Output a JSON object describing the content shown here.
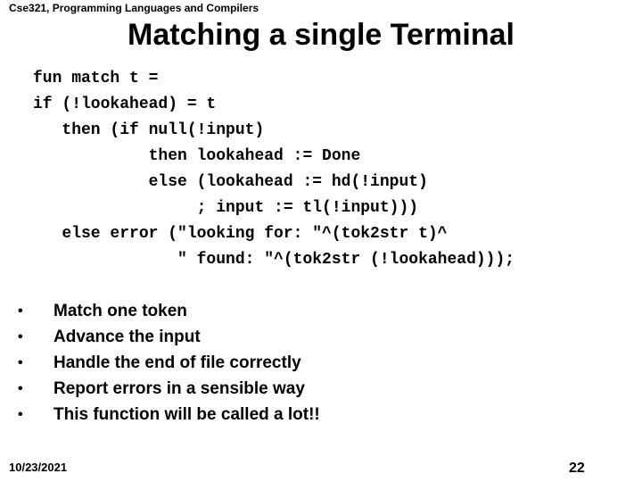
{
  "header": {
    "course": "Cse321, Programming Languages and Compilers"
  },
  "slide": {
    "title": "Matching a single Terminal",
    "code_lines": [
      "fun match t =",
      "if (!lookahead) = t",
      "   then (if null(!input)",
      "            then lookahead := Done",
      "            else (lookahead := hd(!input)",
      "                 ; input := tl(!input)))",
      "   else error (\"looking for: \"^(tok2str t)^",
      "               \" found: \"^(tok2str (!lookahead)));"
    ],
    "bullet_glyph": "•",
    "bullets": [
      "Match one token",
      "Advance the input",
      "Handle the end of file correctly",
      "Report errors in a sensible way",
      "This function will be called a lot!!"
    ]
  },
  "footer": {
    "date": "10/23/2021",
    "page_number": "22"
  }
}
